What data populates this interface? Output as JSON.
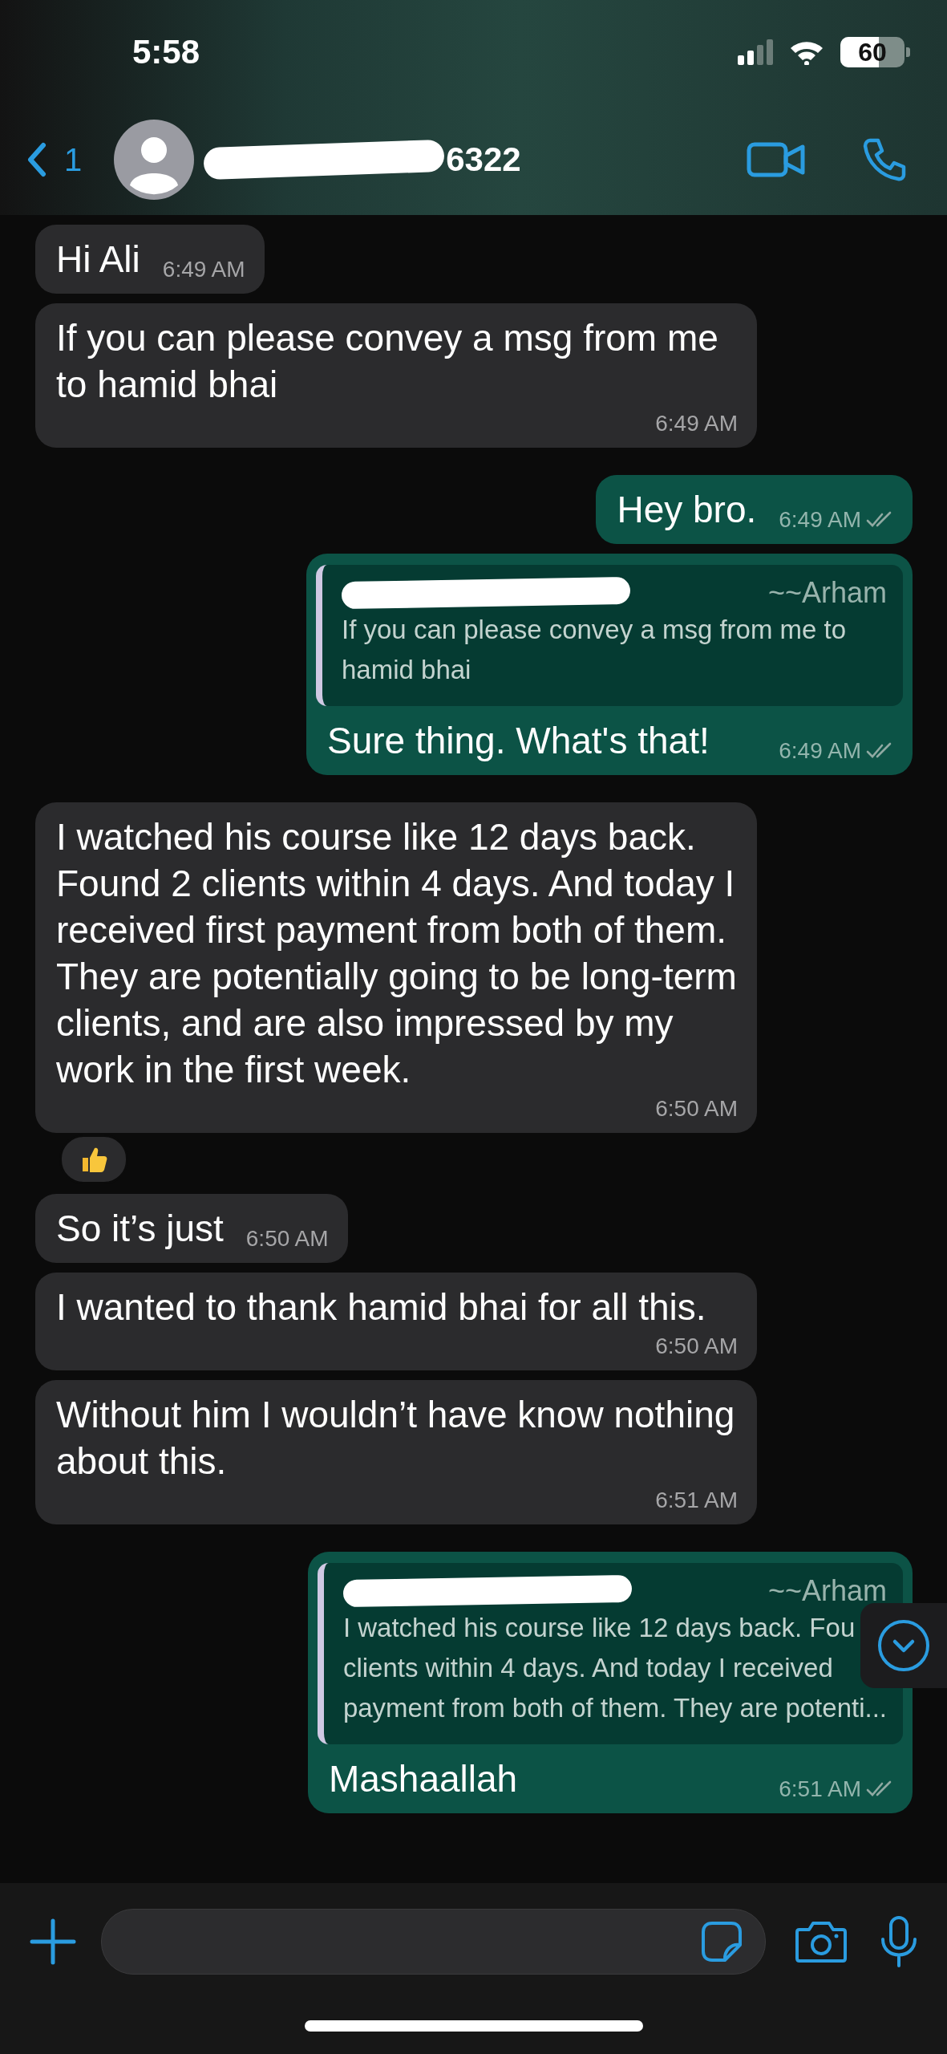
{
  "status_bar": {
    "time": "5:58",
    "battery": "60"
  },
  "header": {
    "back_count": "1",
    "contact_visible": "6322"
  },
  "messages": [
    {
      "kind": "text",
      "outgoing": false,
      "text": "Hi Ali",
      "time": "6:49 AM"
    },
    {
      "kind": "text",
      "outgoing": false,
      "text": "If you can please convey a msg from me to hamid bhai",
      "time": "6:49 AM"
    },
    {
      "kind": "text",
      "outgoing": true,
      "text": "Hey bro.",
      "time": "6:49 AM",
      "read": false
    },
    {
      "kind": "reply",
      "outgoing": true,
      "quote": {
        "author": "~~Arham",
        "lines": [
          "If you can please convey a msg from me to hamid bhai"
        ]
      },
      "text": "Sure thing. What's that!",
      "time": "6:49 AM",
      "read": false
    },
    {
      "kind": "text",
      "outgoing": false,
      "text": "I watched his course like 12 days back. Found 2 clients within 4 days. And today I received first payment from both of them. They are potentially going to be long-term clients, and are also impressed by my work in the first week.",
      "time": "6:50 AM",
      "reacted": true
    },
    {
      "kind": "text",
      "outgoing": false,
      "text": "So it’s just",
      "time": "6:50 AM"
    },
    {
      "kind": "text",
      "outgoing": false,
      "text": "I wanted to thank hamid bhai for all this.",
      "time": "6:50 AM"
    },
    {
      "kind": "text",
      "outgoing": false,
      "text": "Without him I wouldn’t have know nothing about this.",
      "time": "6:51 AM"
    },
    {
      "kind": "reply",
      "outgoing": true,
      "quote": {
        "author": "~~Arham",
        "lines": [
          "I watched his course like 12 days back. Fou",
          "clients within 4 days. And today I received",
          "payment from both of them. They are potenti..."
        ]
      },
      "text": "Mashaallah",
      "time": "6:51 AM",
      "read": false
    }
  ]
}
